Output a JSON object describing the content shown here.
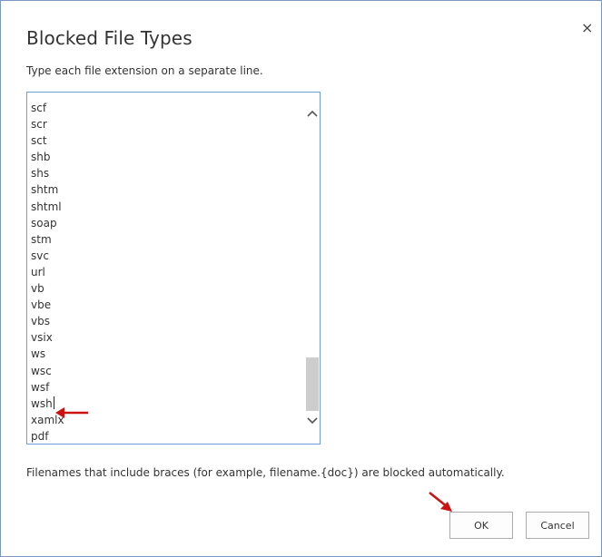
{
  "dialog": {
    "title": "Blocked File Types",
    "close_symbol": "×",
    "instructions": "Type each file extension on a separate line.",
    "extensions": [
      "scf",
      "scr",
      "sct",
      "shb",
      "shs",
      "shtm",
      "shtml",
      "soap",
      "stm",
      "svc",
      "url",
      "vb",
      "vbe",
      "vbs",
      "vsix",
      "ws",
      "wsc",
      "wsf",
      "wsh",
      "xamlx",
      "pdf"
    ],
    "note": "Filenames that include braces (for example, filename.{doc}) are blocked automatically.",
    "ok_label": "OK",
    "cancel_label": "Cancel"
  },
  "colors": {
    "annotation_arrow": "#cc1111",
    "dialog_border": "#7a97c2",
    "textarea_border": "#6f9bd6"
  },
  "icons": {
    "close": "close-icon",
    "scroll_up": "chevron-up-icon",
    "scroll_down": "chevron-down-icon"
  }
}
